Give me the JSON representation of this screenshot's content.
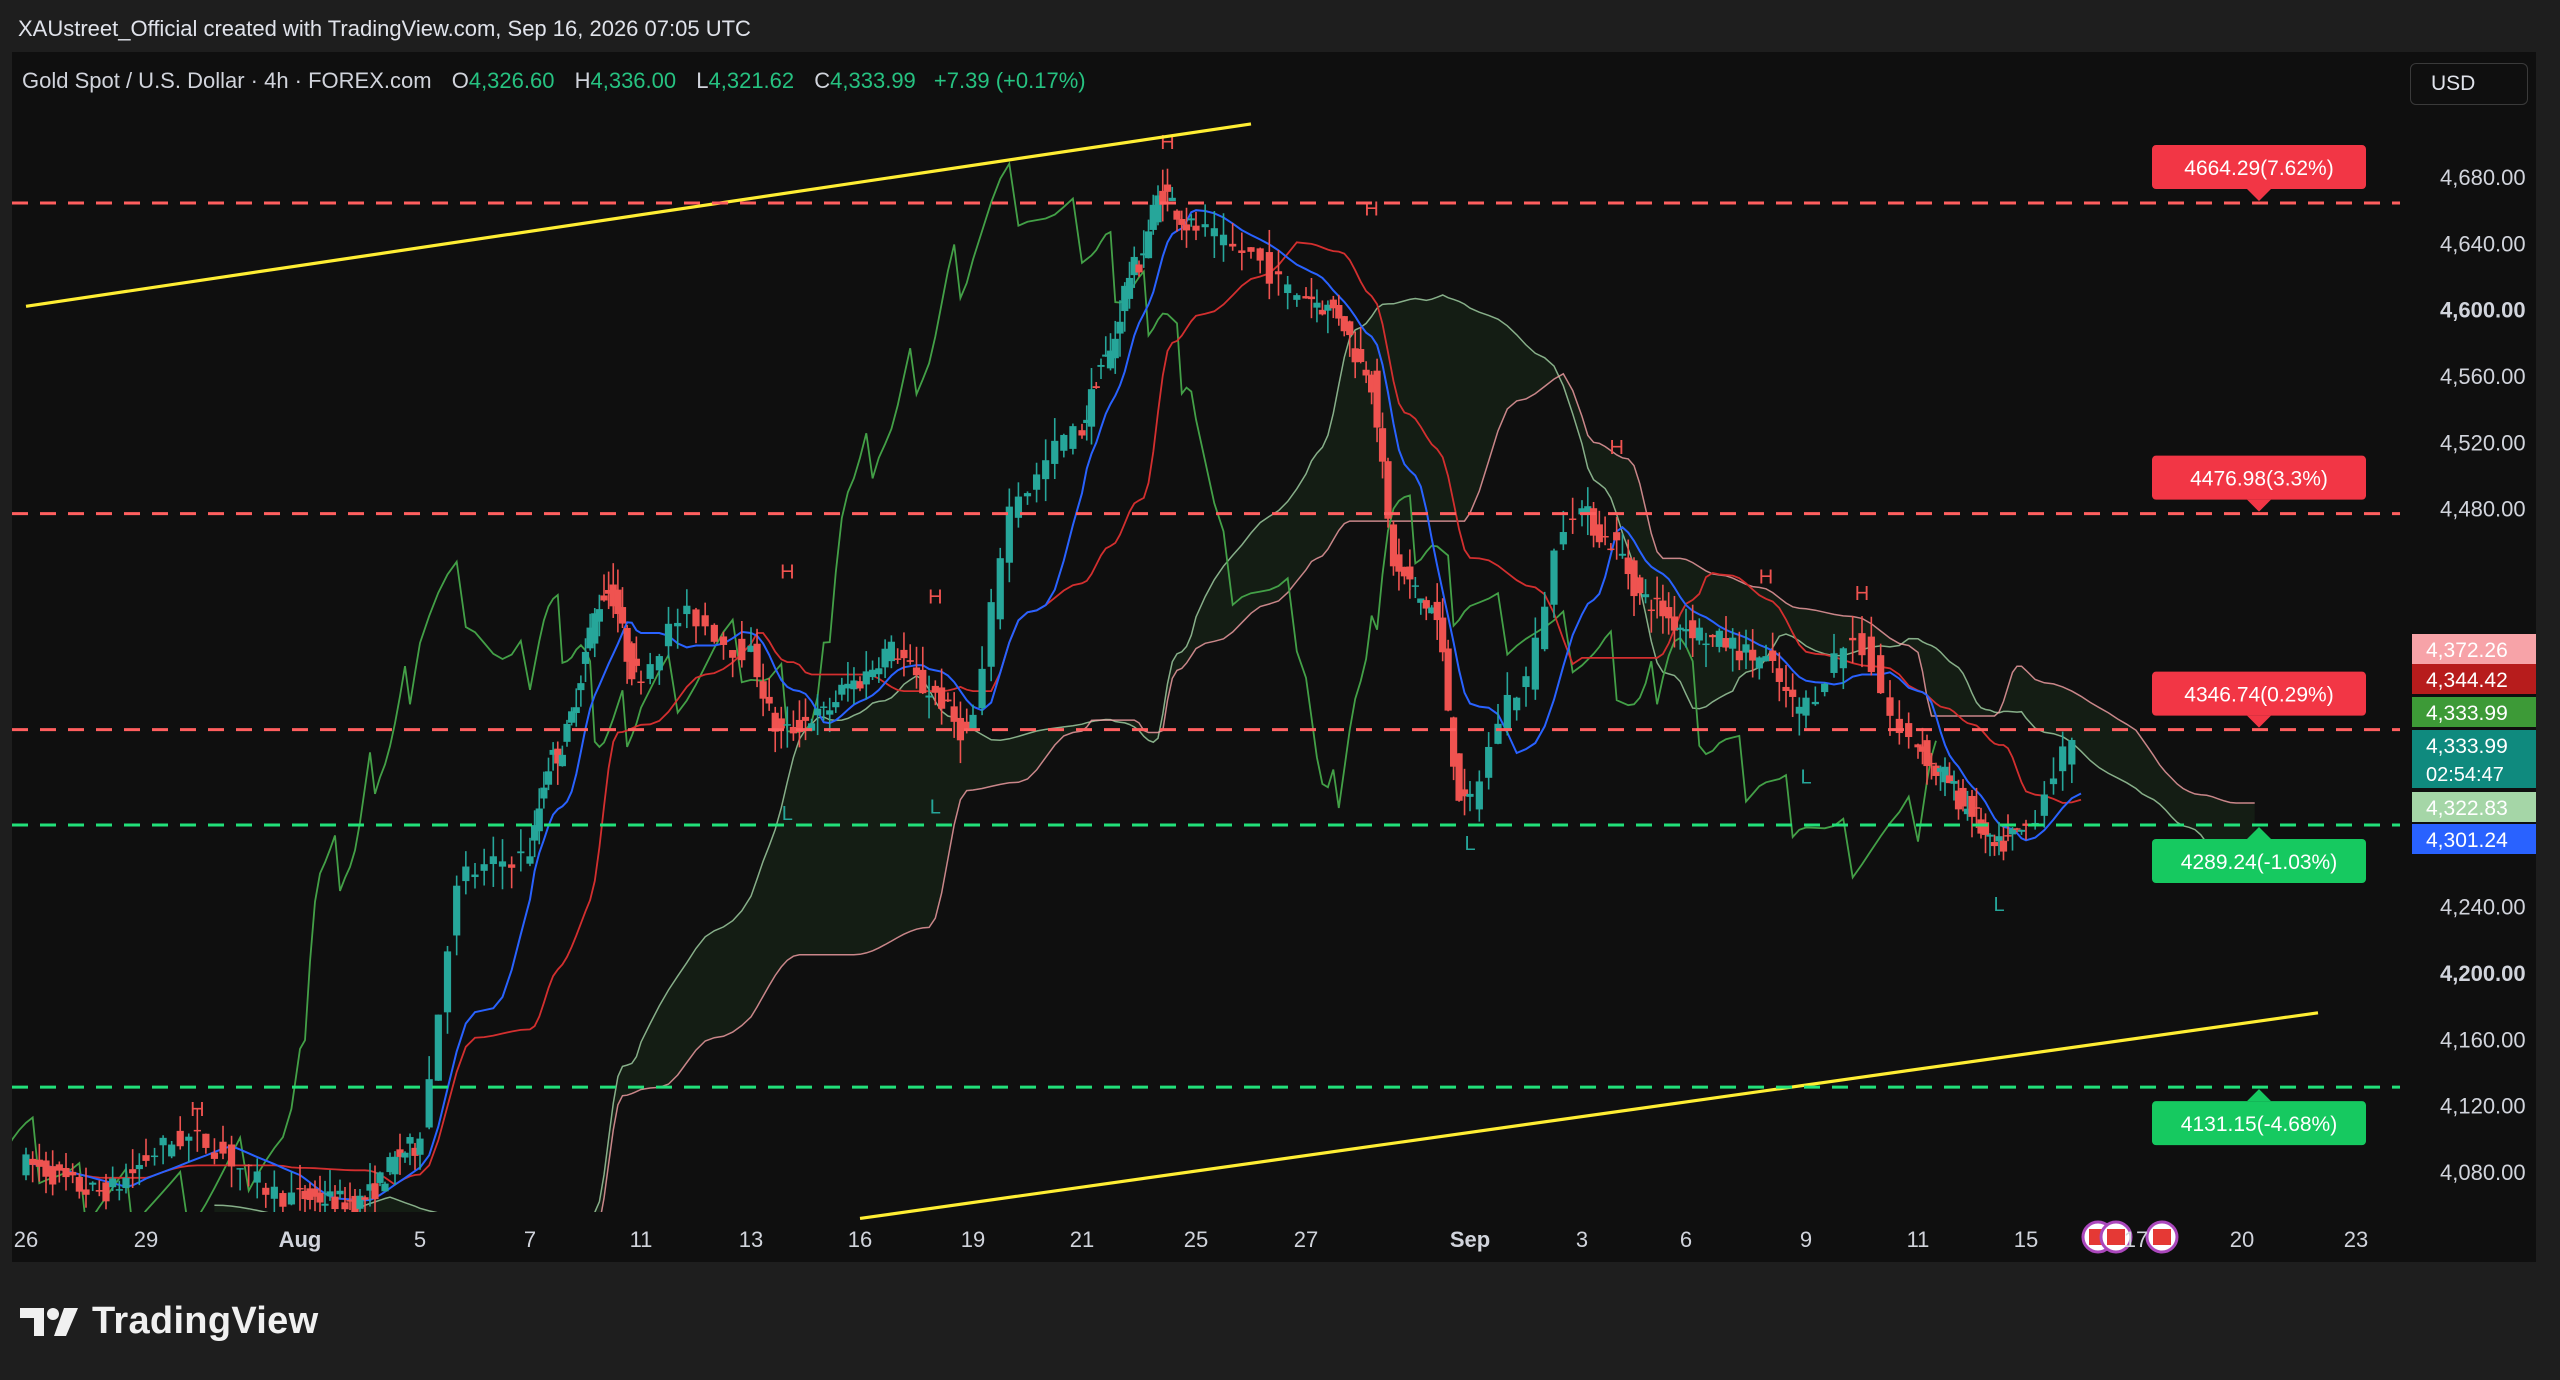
{
  "header": {
    "attribution": "XAUstreet_Official created with TradingView.com, Sep 16, 2026 07:05 UTC"
  },
  "legend": {
    "symbol": "Gold Spot / U.S. Dollar · 4h · FOREX.com",
    "open_label": "O",
    "open": "4,326.60",
    "high_label": "H",
    "high": "4,336.00",
    "low_label": "L",
    "low": "4,321.62",
    "close_label": "C",
    "close": "4,333.99",
    "change": "+7.39 (+0.17%)"
  },
  "currency": "USD",
  "brand": {
    "name": "TradingView"
  },
  "colors": {
    "up": "#26a69a",
    "down": "#ef5350",
    "resistance": "#ff5f5f",
    "support": "#22e07a",
    "channel": "#ffee33",
    "conversion": "#2962ff",
    "base": "#d32f2f",
    "lagging": "#43a047"
  },
  "chart_data": {
    "type": "candlestick",
    "timeframe": "4h",
    "ylim": [
      4050,
      4720
    ],
    "y_ticks": [
      "4,080.00",
      "4,120.00",
      "4,160.00",
      "4,200.00",
      "4,240.00",
      "4,480.00",
      "4,520.00",
      "4,560.00",
      "4,600.00",
      "4,640.00",
      "4,680.00"
    ],
    "y_tick_values": [
      4080,
      4120,
      4160,
      4200,
      4240,
      4480,
      4520,
      4560,
      4600,
      4640,
      4680
    ],
    "x_ticks": [
      "26",
      "29",
      "Aug",
      "5",
      "7",
      "11",
      "13",
      "16",
      "19",
      "21",
      "25",
      "27",
      "Sep",
      "3",
      "6",
      "9",
      "11",
      "15",
      "17",
      "20",
      "23"
    ],
    "x_tick_dates": [
      "2026-07-26",
      "2026-07-29",
      "2026-08-01",
      "2026-08-05",
      "2026-08-07",
      "2026-08-11",
      "2026-08-13",
      "2026-08-16",
      "2026-08-19",
      "2026-08-21",
      "2026-08-25",
      "2026-08-27",
      "2026-09-01",
      "2026-09-03",
      "2026-09-06",
      "2026-09-09",
      "2026-09-11",
      "2026-09-15",
      "2026-09-17",
      "2026-09-20",
      "2026-09-23"
    ],
    "levels": [
      {
        "value": 4664.29,
        "label": "4664.29(7.62%)",
        "kind": "resistance"
      },
      {
        "value": 4476.98,
        "label": "4476.98(3.3%)",
        "kind": "resistance"
      },
      {
        "value": 4346.74,
        "label": "4346.74(0.29%)",
        "kind": "resistance"
      },
      {
        "value": 4289.24,
        "label": "4289.24(-1.03%)",
        "kind": "support"
      },
      {
        "value": 4131.15,
        "label": "4131.15(-4.68%)",
        "kind": "support"
      }
    ],
    "price_tags": [
      {
        "value": 4372.26,
        "label": "4,372.26",
        "color": "#f7a3a8"
      },
      {
        "value": 4344.42,
        "label": "4,344.42",
        "color": "#b71c1c"
      },
      {
        "value": 4333.99,
        "label": "4,333.99",
        "color": "#3d9a37"
      },
      {
        "value": 4333.99,
        "label": "4,333.99",
        "sub": "02:54:47",
        "color": "#0f8a7e"
      },
      {
        "value": 4322.83,
        "label": "4,322.83",
        "color": "#a5d6a7"
      },
      {
        "value": 4301.24,
        "label": "4,301.24",
        "color": "#2962ff"
      }
    ],
    "channel": {
      "upper": [
        {
          "date": "2026-07-26",
          "price": 4602
        },
        {
          "date": "2026-08-26",
          "price": 4712
        }
      ],
      "lower": [
        {
          "date": "2026-08-16",
          "price": 4052
        },
        {
          "date": "2026-09-22",
          "price": 4176
        }
      ]
    },
    "pivots": [
      {
        "type": "H",
        "date": "2026-07-30",
        "price": 4109
      },
      {
        "type": "H",
        "date": "2026-08-14",
        "price": 4433
      },
      {
        "type": "L",
        "date": "2026-08-14",
        "price": 4308
      },
      {
        "type": "H",
        "date": "2026-08-18",
        "price": 4418
      },
      {
        "type": "L",
        "date": "2026-08-18",
        "price": 4312
      },
      {
        "type": "H",
        "date": "2026-08-24",
        "price": 4692
      },
      {
        "type": "H",
        "date": "2026-08-29",
        "price": 4652
      },
      {
        "type": "L",
        "date": "2026-09-01",
        "price": 4290
      },
      {
        "type": "H",
        "date": "2026-09-04",
        "price": 4508
      },
      {
        "type": "H",
        "date": "2026-09-08",
        "price": 4430
      },
      {
        "type": "L",
        "date": "2026-09-09",
        "price": 4330
      },
      {
        "type": "H",
        "date": "2026-09-10",
        "price": 4420
      },
      {
        "type": "L",
        "date": "2026-09-14",
        "price": 4253
      }
    ],
    "price_path": [
      [
        "2026-07-26",
        4085
      ],
      [
        "2026-07-28",
        4068
      ],
      [
        "2026-07-30",
        4100
      ],
      [
        "2026-08-01",
        4065
      ],
      [
        "2026-08-03",
        4062
      ],
      [
        "2026-08-05",
        4095
      ],
      [
        "2026-08-06",
        4260
      ],
      [
        "2026-08-07",
        4270
      ],
      [
        "2026-08-08",
        4330
      ],
      [
        "2026-08-10",
        4430
      ],
      [
        "2026-08-11",
        4380
      ],
      [
        "2026-08-12",
        4415
      ],
      [
        "2026-08-13",
        4395
      ],
      [
        "2026-08-14",
        4345
      ],
      [
        "2026-08-15",
        4355
      ],
      [
        "2026-08-16",
        4375
      ],
      [
        "2026-08-17",
        4395
      ],
      [
        "2026-08-18",
        4370
      ],
      [
        "2026-08-19",
        4345
      ],
      [
        "2026-08-20",
        4490
      ],
      [
        "2026-08-21",
        4525
      ],
      [
        "2026-08-22",
        4570
      ],
      [
        "2026-08-23",
        4625
      ],
      [
        "2026-08-24",
        4670
      ],
      [
        "2026-08-25",
        4650
      ],
      [
        "2026-08-26",
        4635
      ],
      [
        "2026-08-27",
        4610
      ],
      [
        "2026-08-28",
        4600
      ],
      [
        "2026-08-29",
        4565
      ],
      [
        "2026-08-30",
        4440
      ],
      [
        "2026-08-31",
        4420
      ],
      [
        "2026-09-01",
        4300
      ],
      [
        "2026-09-02",
        4370
      ],
      [
        "2026-09-03",
        4480
      ],
      [
        "2026-09-04",
        4460
      ],
      [
        "2026-09-05",
        4425
      ],
      [
        "2026-09-06",
        4410
      ],
      [
        "2026-09-07",
        4400
      ],
      [
        "2026-09-08",
        4390
      ],
      [
        "2026-09-09",
        4360
      ],
      [
        "2026-09-10",
        4400
      ],
      [
        "2026-09-11",
        4340
      ],
      [
        "2026-09-12",
        4320
      ],
      [
        "2026-09-13",
        4300
      ],
      [
        "2026-09-14",
        4275
      ],
      [
        "2026-09-15",
        4285
      ],
      [
        "2026-09-16",
        4334
      ]
    ]
  }
}
